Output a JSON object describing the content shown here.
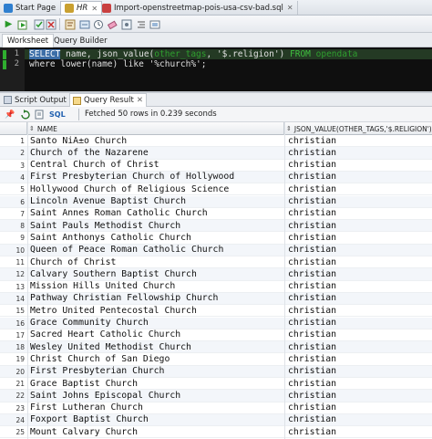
{
  "doc_tabs": [
    {
      "label": "Start Page",
      "icon": "start-page-icon",
      "icon_color": "#2f7fcf"
    },
    {
      "label": "HR",
      "icon": "connection-icon",
      "icon_color": "#c9a030"
    },
    {
      "label": "Import-openstreetmap-pois-usa-csv-bad.sql",
      "icon": "sql-file-icon",
      "icon_color": "#c94040"
    }
  ],
  "worksheet_tabs": [
    "Worksheet",
    "Query Builder"
  ],
  "editor": {
    "line_numbers": [
      "1",
      "2"
    ],
    "line1": {
      "kw1": "SELECT",
      "p1": " name, json_value(",
      "hl": "other_tags",
      "p2": ", '$.religion') ",
      "kw2": "FROM",
      "p3": " ",
      "hl2": "opendata"
    },
    "line2": {
      "p1": "where lower(name) like ",
      "str": "'%church%'",
      "p2": ";"
    }
  },
  "result_tabs": [
    {
      "label": "Script Output",
      "icon": "script-output-icon"
    },
    {
      "label": "Query Result",
      "icon": "query-result-icon"
    }
  ],
  "result_toolbar": {
    "sql_label": "SQL",
    "fetch_status": "Fetched 50 rows in 0.239 seconds"
  },
  "grid": {
    "columns": [
      "NAME",
      "JSON_VALUE(OTHER_TAGS,'$.RELIGION')"
    ],
    "rows": [
      [
        "1",
        "Santo NiÃ±o Church",
        "christian"
      ],
      [
        "2",
        "Church of the Nazarene",
        "christian"
      ],
      [
        "3",
        "Central Church of Christ",
        "christian"
      ],
      [
        "4",
        "First Presbyterian Church of Hollywood",
        "christian"
      ],
      [
        "5",
        "Hollywood Church of Religious Science",
        "christian"
      ],
      [
        "6",
        "Lincoln Avenue Baptist Church",
        "christian"
      ],
      [
        "7",
        "Saint Annes Roman Catholic Church",
        "christian"
      ],
      [
        "8",
        "Saint Pauls Methodist Church",
        "christian"
      ],
      [
        "9",
        "Saint Anthonys Catholic Church",
        "christian"
      ],
      [
        "10",
        "Queen of Peace Roman Catholic Church",
        "christian"
      ],
      [
        "11",
        "Church of Christ",
        "christian"
      ],
      [
        "12",
        "Calvary Southern Baptist Church",
        "christian"
      ],
      [
        "13",
        "Mission Hills United Church",
        "christian"
      ],
      [
        "14",
        "Pathway Christian Fellowship Church",
        "christian"
      ],
      [
        "15",
        "Metro United Pentecostal Church",
        "christian"
      ],
      [
        "16",
        "Grace Community Church",
        "christian"
      ],
      [
        "17",
        "Sacred Heart Catholic Church",
        "christian"
      ],
      [
        "18",
        "Wesley United Methodist Church",
        "christian"
      ],
      [
        "19",
        "Christ Church of San Diego",
        "christian"
      ],
      [
        "20",
        "First Presbyterian Church",
        "christian"
      ],
      [
        "21",
        "Grace Baptist Church",
        "christian"
      ],
      [
        "22",
        "Saint Johns Episcopal Church",
        "christian"
      ],
      [
        "23",
        "First Lutheran Church",
        "christian"
      ],
      [
        "24",
        "Foxport Baptist Church",
        "christian"
      ],
      [
        "25",
        "Mount Calvary Church",
        "christian"
      ]
    ]
  },
  "colors": {
    "keyword": "#3fbf3f",
    "editor_bg": "#0f0f0f",
    "row_alt": "#f3f6fa"
  }
}
